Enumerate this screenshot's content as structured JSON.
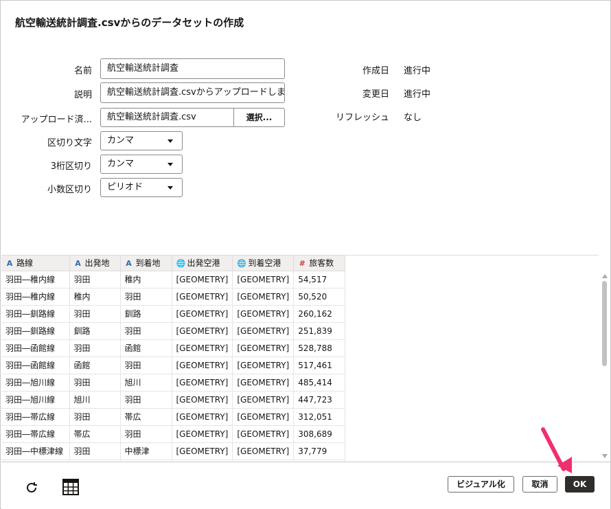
{
  "dialog": {
    "title": "航空輸送統計調査.csvからのデータセットの作成"
  },
  "form": {
    "name_label": "名前",
    "name_value": "航空輸送統計調査",
    "desc_label": "説明",
    "desc_value": "航空輸送統計調査.csvからアップロードしま",
    "upload_label": "アップロード済...",
    "upload_value": "航空輸送統計調査.csv",
    "select_button": "選択...",
    "delimiter_label": "区切り文字",
    "delimiter_value": "カンマ",
    "thousands_label": "3桁区切り",
    "thousands_value": "カンマ",
    "decimal_label": "小数区切り",
    "decimal_value": "ピリオド"
  },
  "info": {
    "created_label": "作成日",
    "created_value": "進行中",
    "modified_label": "変更日",
    "modified_value": "進行中",
    "refresh_label": "リフレッシュ",
    "refresh_value": "なし"
  },
  "table": {
    "columns": [
      {
        "label": "路線",
        "type_icon": "text-type-icon",
        "glyph": "A"
      },
      {
        "label": "出発地",
        "type_icon": "text-type-icon",
        "glyph": "A"
      },
      {
        "label": "到着地",
        "type_icon": "text-type-icon",
        "glyph": "A"
      },
      {
        "label": "出発空港",
        "type_icon": "geometry-type-icon",
        "glyph": "🌐"
      },
      {
        "label": "到着空港",
        "type_icon": "geometry-type-icon",
        "glyph": "🌐"
      },
      {
        "label": "旅客数",
        "type_icon": "number-type-icon",
        "glyph": "#"
      }
    ],
    "rows": [
      [
        "羽田―稚内線",
        "羽田",
        "稚内",
        "[GEOMETRY]",
        "[GEOMETRY]",
        "54,517"
      ],
      [
        "羽田―稚内線",
        "稚内",
        "羽田",
        "[GEOMETRY]",
        "[GEOMETRY]",
        "50,520"
      ],
      [
        "羽田―釧路線",
        "羽田",
        "釧路",
        "[GEOMETRY]",
        "[GEOMETRY]",
        "260,162"
      ],
      [
        "羽田―釧路線",
        "釧路",
        "羽田",
        "[GEOMETRY]",
        "[GEOMETRY]",
        "251,839"
      ],
      [
        "羽田―函館線",
        "羽田",
        "函館",
        "[GEOMETRY]",
        "[GEOMETRY]",
        "528,788"
      ],
      [
        "羽田―函館線",
        "函館",
        "羽田",
        "[GEOMETRY]",
        "[GEOMETRY]",
        "517,461"
      ],
      [
        "羽田―旭川線",
        "羽田",
        "旭川",
        "[GEOMETRY]",
        "[GEOMETRY]",
        "485,414"
      ],
      [
        "羽田―旭川線",
        "旭川",
        "羽田",
        "[GEOMETRY]",
        "[GEOMETRY]",
        "447,723"
      ],
      [
        "羽田―帯広線",
        "羽田",
        "帯広",
        "[GEOMETRY]",
        "[GEOMETRY]",
        "312,051"
      ],
      [
        "羽田―帯広線",
        "帯広",
        "羽田",
        "[GEOMETRY]",
        "[GEOMETRY]",
        "308,689"
      ],
      [
        "羽田―中標津線",
        "羽田",
        "中標津",
        "[GEOMETRY]",
        "[GEOMETRY]",
        "37,779"
      ],
      [
        "",
        "",
        "",
        "",
        "",
        ""
      ]
    ]
  },
  "footer": {
    "refresh_icon": "refresh-icon",
    "grid_icon": "grid-icon",
    "visualize_button": "ビジュアル化",
    "cancel_button": "取消",
    "ok_button": "OK"
  },
  "colors": {
    "primary_button": "#312d2a",
    "pointer_arrow": "#f0306e"
  }
}
